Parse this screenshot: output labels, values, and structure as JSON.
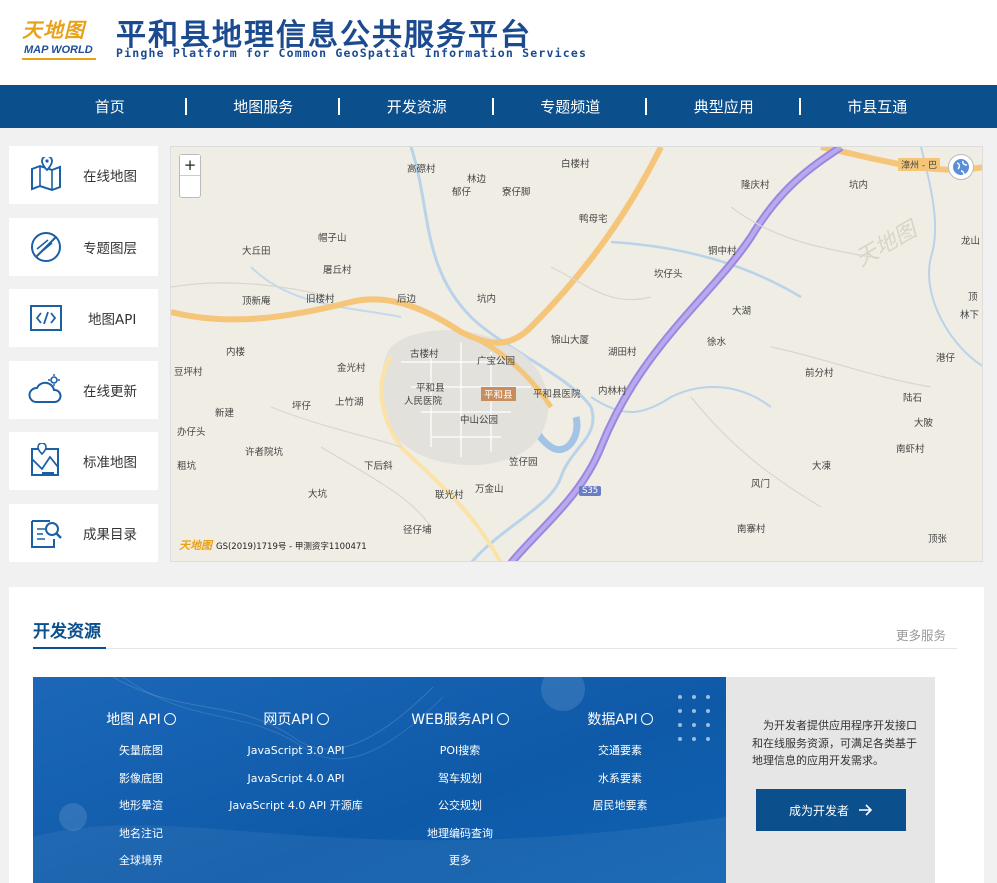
{
  "header": {
    "logo_cn": "天地图",
    "logo_en": "MAP WORLD",
    "title_cn": "平和县地理信息公共服务平台",
    "title_en": "Pinghe Platform for Common GeoSpatial Information Services"
  },
  "nav": {
    "items": [
      "首页",
      "地图服务",
      "开发资源",
      "专题频道",
      "典型应用",
      "市县互通"
    ]
  },
  "sidebar": {
    "items": [
      {
        "label": "在线地图",
        "icon": "map-pin-icon"
      },
      {
        "label": "专题图层",
        "icon": "layer-icon"
      },
      {
        "label": "地图API",
        "icon": "code-icon"
      },
      {
        "label": "在线更新",
        "icon": "cloud-update-icon"
      },
      {
        "label": "标准地图",
        "icon": "standard-map-icon"
      },
      {
        "label": "成果目录",
        "icon": "catalog-search-icon"
      }
    ]
  },
  "map": {
    "zoom_in": "+",
    "zoom_out": "−",
    "copyright_logo": "天地图",
    "copyright": "GS(2019)1719号 - 甲测资字1100471",
    "places": [
      "高磜村",
      "林边",
      "白楼村",
      "郁仔",
      "寮仔脚",
      "鸭母宅",
      "隆庆村",
      "坑内",
      "帽子山",
      "大丘田",
      "铜中村",
      "龙山",
      "坎仔头",
      "屠丘村",
      "顶新庵",
      "旧楼村",
      "后边",
      "坑内",
      "大湖",
      "林下",
      "顶",
      "锦山大厦",
      "湖田村",
      "徐水",
      "内楼",
      "古楼村",
      "广宝公园",
      "港仔",
      "豆坪村",
      "金光村",
      "平和县",
      "平和县医院",
      "内林村",
      "前分村",
      "人民医院",
      "中山公园",
      "陆石",
      "新建",
      "坪仔",
      "上竹湖",
      "大陂",
      "办仔头",
      "许者院坑",
      "南虾村",
      "下后斜",
      "笠仔园",
      "大凍",
      "粗坑",
      "大坑",
      "联光村",
      "万金山",
      "风门",
      "径仔埔",
      "南寨村",
      "顶张"
    ],
    "road_labels": [
      "S35",
      "漳州 - 巴"
    ],
    "county_marker": "平和县"
  },
  "dev_panel": {
    "title": "开发资源",
    "more": "更多服务",
    "columns": [
      {
        "header": "地图 API",
        "items": [
          "矢量底图",
          "影像底图",
          "地形晕渲",
          "地名注记",
          "全球境界"
        ]
      },
      {
        "header": "网页API",
        "items": [
          "JavaScript 3.0 API",
          "JavaScript 4.0 API",
          "JavaScript 4.0 API 开源库"
        ]
      },
      {
        "header": "WEB服务API",
        "items": [
          "POI搜索",
          "驾车规划",
          "公交规划",
          "地理编码查询",
          "更多"
        ]
      },
      {
        "header": "数据API",
        "items": [
          "交通要素",
          "水系要素",
          "居民地要素"
        ]
      }
    ],
    "description": "为开发者提供应用程序开发接口和在线服务资源，可满足各类基于地理信息的应用开发需求。",
    "cta": "成为开发者"
  },
  "colors": {
    "brand_blue": "#0b4f8d",
    "accent_orange": "#e8a21a",
    "road_orange": "#f7c47a",
    "expressway_purple": "#9f86e0"
  }
}
